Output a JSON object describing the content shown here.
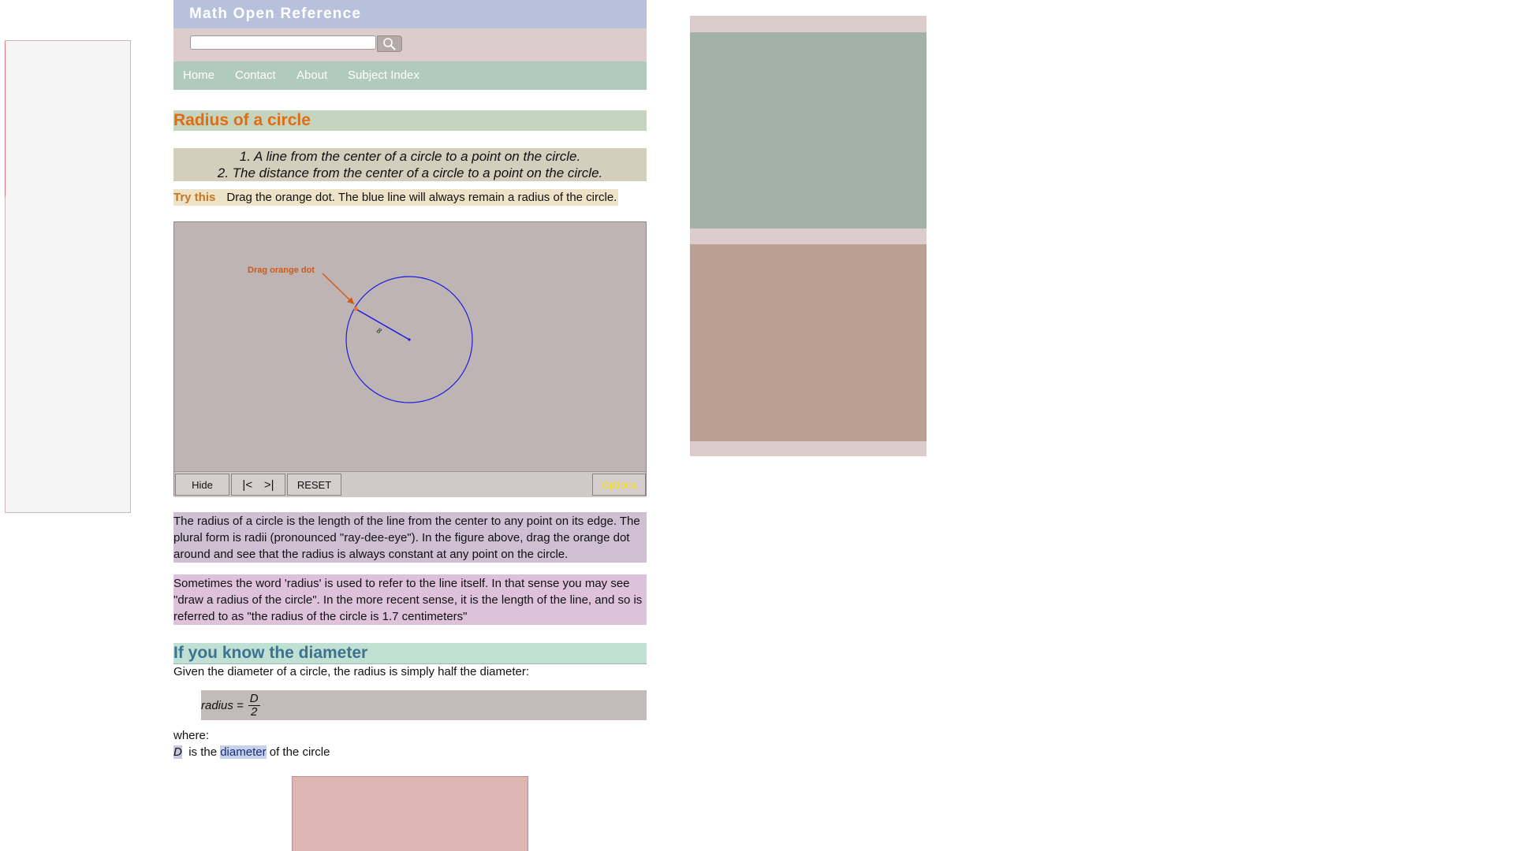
{
  "site": {
    "title": "Math Open Reference",
    "search_placeholder": "",
    "nav": [
      "Home",
      "Contact",
      "About",
      "Subject Index"
    ]
  },
  "page": {
    "title": "Radius of a circle",
    "definitions": [
      "1. A line from the center of a circle to a point on the circle.",
      "2. The distance from the center of a circle to a point on the circle."
    ],
    "try_this": {
      "label": "Try this",
      "text": "Drag the orange dot. The blue line will always remain a radius of the circle."
    }
  },
  "applet": {
    "drag_hint": "Drag orange dot",
    "radius_label": "8",
    "controls": {
      "hide": "Hide",
      "first": "|<",
      "last": ">|",
      "reset": "RESET",
      "options": "Options"
    },
    "colors": {
      "circle": "#1d1ddf",
      "hint": "#d05a14",
      "options_text": "#f2e600"
    }
  },
  "body": {
    "para1": "The radius of a circle is the length of the line from the center to any point on its edge. The plural form is radii (pronounced \"ray-dee-eye\"). In the figure above, drag the orange dot around and see that the radius is always constant at any point on the circle.",
    "para2": "Sometimes the word 'radius' is used to refer to the line itself. In that sense you may see \"draw a radius of the circle\". In the more recent sense, it is the length of the line, and so is referred to as \"the radius of the circle is 1.7 centimeters\"",
    "diameter_heading": "If you know the diameter",
    "diameter_intro": "Given the diameter of a circle, the radius is simply half the diameter:",
    "formula": {
      "lhs": "radius =",
      "numerator": "D",
      "denominator": "2"
    },
    "where": "where:",
    "variable": {
      "symbol": "D",
      "text_before": "is the",
      "link": "diameter",
      "text_after": "of the circle"
    }
  }
}
